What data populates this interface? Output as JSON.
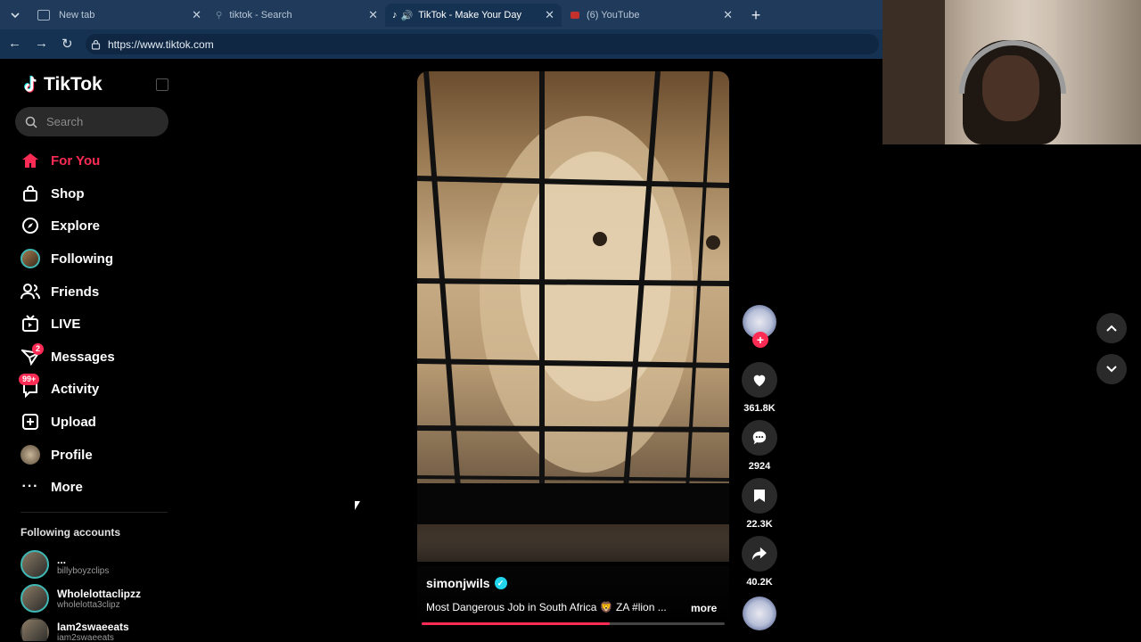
{
  "browser": {
    "tabs": [
      {
        "title": "New tab",
        "active": false
      },
      {
        "title": "tiktok - Search",
        "active": false
      },
      {
        "title": "TikTok - Make Your Day",
        "active": true
      },
      {
        "title": "(6) YouTube",
        "active": false
      }
    ],
    "url": "https://www.tiktok.com"
  },
  "app": {
    "logo_text": "TikTok",
    "search_placeholder": "Search"
  },
  "nav": [
    {
      "label": "For You",
      "icon": "home-icon",
      "active": true
    },
    {
      "label": "Shop",
      "icon": "shopping-bag-icon"
    },
    {
      "label": "Explore",
      "icon": "compass-icon"
    },
    {
      "label": "Following",
      "icon": "avatar-icon"
    },
    {
      "label": "Friends",
      "icon": "friends-icon"
    },
    {
      "label": "LIVE",
      "icon": "live-tv-icon"
    },
    {
      "label": "Messages",
      "icon": "paper-plane-icon",
      "badge": "2"
    },
    {
      "label": "Activity",
      "icon": "chat-bell-icon",
      "badge": "99+"
    },
    {
      "label": "Upload",
      "icon": "plus-square-icon"
    },
    {
      "label": "Profile",
      "icon": "avatar-icon"
    },
    {
      "label": "More",
      "icon": "ellipsis-icon"
    }
  ],
  "following_accounts": {
    "title": "Following accounts",
    "items": [
      {
        "name": "...",
        "handle": "billyboyzclips"
      },
      {
        "name": "Wholelottaclipzz",
        "handle": "wholelotta3clipz"
      },
      {
        "name": "Iam2swaeeats",
        "handle": "iam2swaeeats"
      }
    ]
  },
  "video": {
    "author": "simonjwils",
    "verified": true,
    "caption": "Most Dangerous Job in South Africa 🦁 ZA #lion ...",
    "more_label": "more",
    "progress": 0.62
  },
  "actions": {
    "likes": "361.8K",
    "comments": "2924",
    "saves": "22.3K",
    "shares": "40.2K"
  },
  "colors": {
    "accent": "#fe2c55",
    "verify": "#20d5ec",
    "tabbar": "#1f3a5a"
  }
}
